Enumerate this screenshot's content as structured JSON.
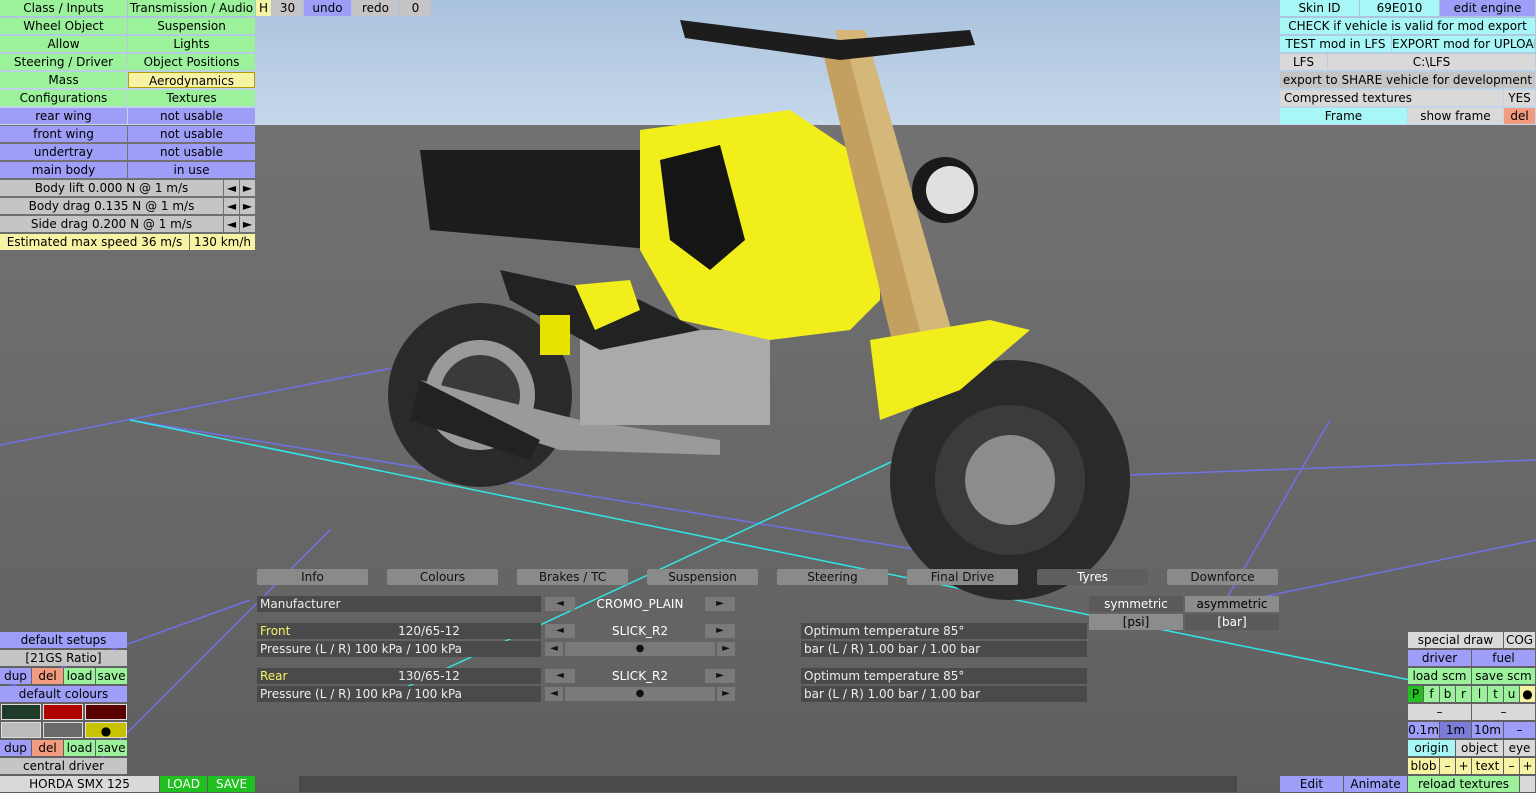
{
  "left_menu": {
    "rows": [
      [
        "Class / Inputs",
        "Transmission / Audio"
      ],
      [
        "Wheel Object",
        "Suspension"
      ],
      [
        "Allow",
        "Lights"
      ],
      [
        "Steering / Driver",
        "Object Positions"
      ],
      [
        "Mass",
        "Aerodynamics"
      ],
      [
        "Configurations",
        "Textures"
      ]
    ],
    "aero": [
      [
        "rear wing",
        "not usable"
      ],
      [
        "front wing",
        "not usable"
      ],
      [
        "undertray",
        "not usable"
      ],
      [
        "main body",
        "in use"
      ]
    ],
    "drag": [
      "Body lift 0.000 N @ 1 m/s",
      "Body drag 0.135 N @ 1 m/s",
      "Side drag 0.200 N @ 1 m/s"
    ],
    "arrow_left": "◄",
    "arrow_right": "►",
    "speed_label": "Estimated max speed 36 m/s",
    "speed_kmh": "130 km/h"
  },
  "top_toolbar": {
    "h": "H",
    "count": "30",
    "undo": "undo",
    "redo": "redo",
    "zero": "0"
  },
  "top_right": {
    "skin_id_label": "Skin ID",
    "skin_id": "69E010",
    "edit_engine": "edit engine",
    "check": "CHECK if vehicle is valid for mod export",
    "test": "TEST mod in LFS",
    "export": "EXPORT mod for UPLOAD",
    "lfs": "LFS",
    "path": "C:\\LFS",
    "share": "export to SHARE vehicle for development",
    "compressed": "Compressed textures",
    "yes": "YES",
    "frame": "Frame",
    "show_frame": "show frame",
    "del": "del"
  },
  "tabs": [
    "Info",
    "Colours",
    "Brakes / TC",
    "Suspension",
    "Steering",
    "Final Drive",
    "Tyres",
    "Downforce"
  ],
  "selected_tab": "Tyres",
  "tyres": {
    "manufacturer_label": "Manufacturer",
    "manufacturer": "CROMO_PLAIN",
    "front_label": "Front",
    "front_size": "120/65-12",
    "front_compound": "SLICK_R2",
    "front_pressure": "Pressure (L / R) 100 kPa / 100 kPa",
    "rear_label": "Rear",
    "rear_size": "130/65-12",
    "rear_compound": "SLICK_R2",
    "rear_pressure": "Pressure (L / R) 100 kPa / 100 kPa",
    "front_opt_temp": "Optimum temperature 85°",
    "front_bar": "bar (L / R) 1.00 bar / 1.00 bar",
    "rear_opt_temp": "Optimum temperature 85°",
    "rear_bar": "bar (L / R) 1.00 bar / 1.00 bar",
    "symmetric": "symmetric",
    "asymmetric": "asymmetric",
    "psi": "[psi]",
    "bar": "[bar]",
    "left": "◄",
    "right": "►",
    "dot": "●"
  },
  "bottom_left": {
    "default_setups": "default setups",
    "ratio": "[21GS Ratio]",
    "dup": "dup",
    "del": "del",
    "load": "load",
    "save": "save",
    "default_colours": "default colours",
    "central_driver": "central driver",
    "car_name": "HORDA SMX 125",
    "load_btn": "LOAD",
    "save_btn": "SAVE",
    "swatches": [
      "#1f3a28",
      "#b00000",
      "#5a0000",
      "#bbbbbb",
      "#6a6a6a",
      "#c9c200"
    ]
  },
  "bottom_right": {
    "special_draw": "special draw",
    "cog": "COG",
    "driver": "driver",
    "fuel": "fuel",
    "load_scm": "load scm",
    "save_scm": "save scm",
    "letters": [
      "P",
      "f",
      "b",
      "r",
      "l",
      "t",
      "u",
      "●"
    ],
    "dash": "–",
    "d01": "0.1m",
    "d1": "1m",
    "d10": "10m",
    "origin": "origin",
    "object": "object",
    "eye": "eye",
    "blob": "blob",
    "minus": "–",
    "plus": "+",
    "text": "text",
    "edit": "Edit",
    "animate": "Animate",
    "reload": "reload textures"
  }
}
